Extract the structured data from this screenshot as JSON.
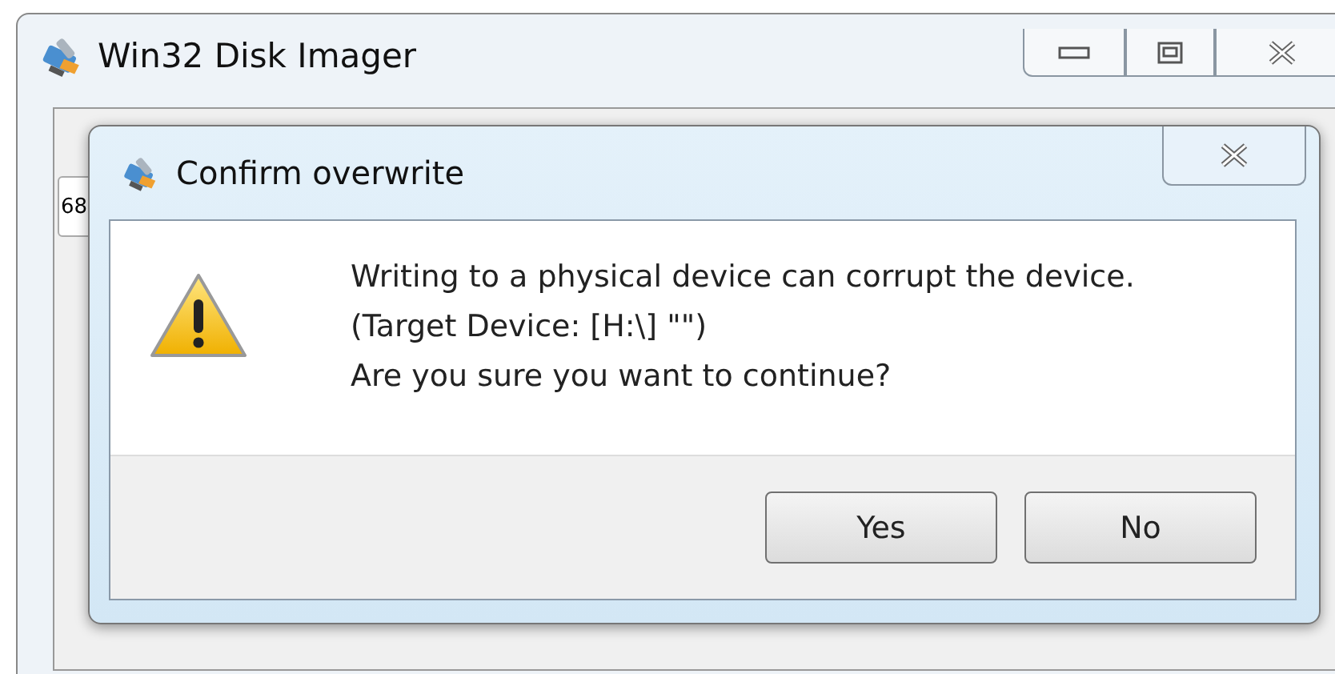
{
  "window": {
    "title": "Win32 Disk Imager",
    "image_file_value": "68"
  },
  "dialog": {
    "title": "Confirm overwrite",
    "lines": [
      "Writing to a physical device can corrupt the device.",
      "(Target Device: [H:\\] \"\")",
      "Are you sure you want to continue?"
    ],
    "buttons": [
      {
        "label": "Yes",
        "selected": false
      },
      {
        "label": "No",
        "selected": false
      }
    ]
  }
}
